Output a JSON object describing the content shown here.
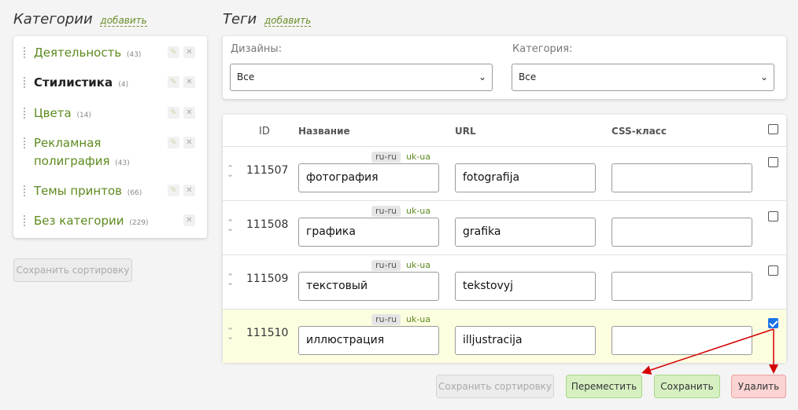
{
  "categories": {
    "title": "Категории",
    "add_link": "добавить",
    "items": [
      {
        "label": "Деятельность",
        "count": "(43)"
      },
      {
        "label": "Стилистика",
        "count": "(4)"
      },
      {
        "label": "Цвета",
        "count": "(14)"
      },
      {
        "label": "Рекламная полиграфия",
        "count": "(43)"
      },
      {
        "label": "Темы принтов",
        "count": "(66)"
      },
      {
        "label": "Без категории",
        "count": "(229)"
      }
    ],
    "save_sort_label": "Сохранить сортировку"
  },
  "tags": {
    "title": "Теги",
    "add_link": "добавить",
    "filters": {
      "designs_label": "Дизайны:",
      "designs_value": "Все",
      "category_label": "Категория:",
      "category_value": "Все"
    },
    "columns": {
      "id": "ID",
      "name": "Название",
      "url": "URL",
      "css": "CSS-класс"
    },
    "lang_ru": "ru-ru",
    "lang_uk": "uk-ua",
    "rows": [
      {
        "id": "111507",
        "name": "фотография",
        "url": "fotografija",
        "css": "",
        "checked": false
      },
      {
        "id": "111508",
        "name": "графика",
        "url": "grafika",
        "css": "",
        "checked": false
      },
      {
        "id": "111509",
        "name": "текстовый",
        "url": "tekstovyj",
        "css": "",
        "checked": false
      },
      {
        "id": "111510",
        "name": "иллюстрация",
        "url": "illjustracija",
        "css": "",
        "checked": true
      }
    ],
    "buttons": {
      "save_sort": "Сохранить сортировку",
      "move": "Переместить",
      "save": "Сохранить",
      "delete": "Удалить"
    }
  },
  "colors": {
    "accent_green": "#5d8a1e",
    "annotation_arrow": "#d40000",
    "selected_row": "#fdfde0"
  },
  "icons": {
    "edit": "pencil-icon",
    "remove": "close-icon",
    "drag": "drag-handle-icon",
    "select": "chevron-down-icon"
  }
}
